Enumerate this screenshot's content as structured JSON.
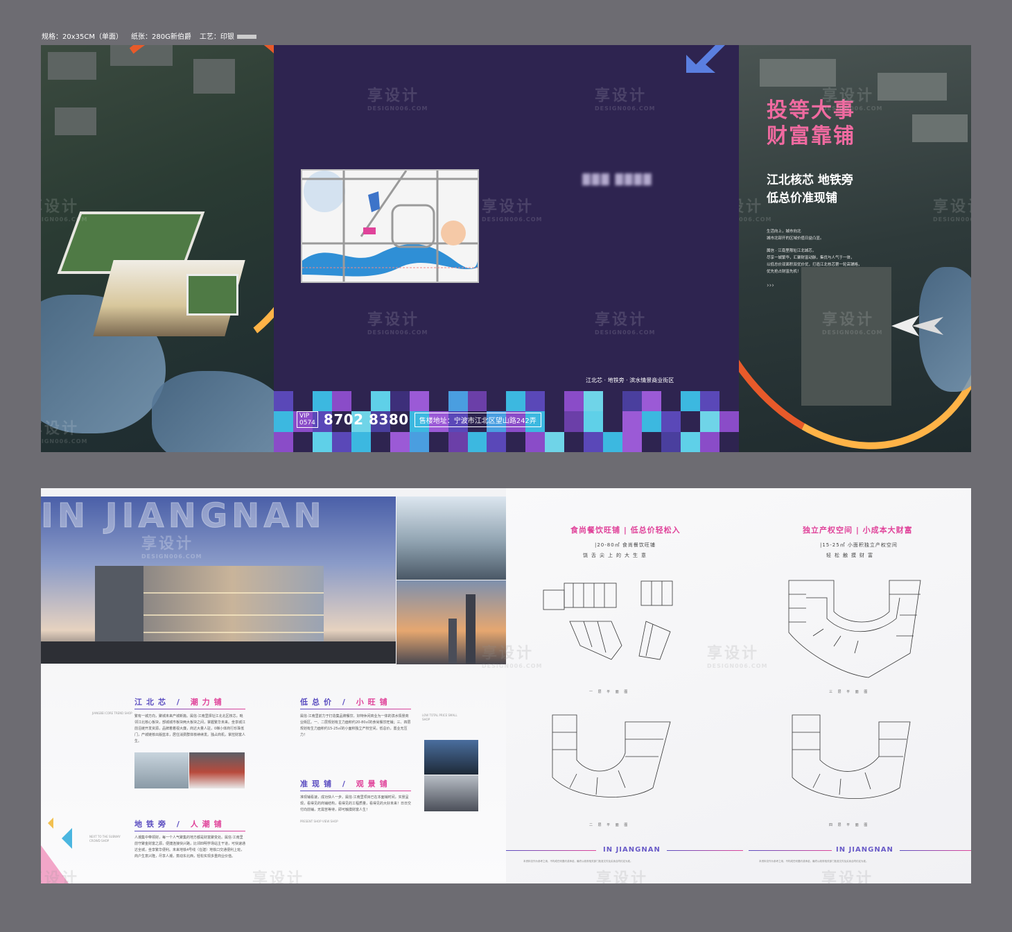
{
  "spec": {
    "size": "规格：20x35CM（单面）",
    "paper": "纸张：280G新伯爵",
    "craft": "工艺：印银"
  },
  "watermark": {
    "cn": "享设计",
    "en": "DESIGN006.COM"
  },
  "cover": {
    "tagline": "江北芯 · 地铁旁 · 滨水情景商业街区",
    "vip_label": "VIP",
    "area_code": "0574",
    "phone": "8702 8380",
    "address": "售楼地址：宁波市江北区望山路242弄"
  },
  "promo": {
    "headline_1": "投等大事",
    "headline_2": "财富靠铺",
    "sub_1": "江北核芯 地铁旁",
    "sub_2": "低总价准现铺",
    "body_1": "生活向上，城市向北",
    "body_2": "城市北部开的区域价值日益凸显。",
    "body_3": "属信 · 江南里限址江北城芯，",
    "body_4": "尽享一城繁华，汇聚财富动脉，集优与人气于一体，",
    "body_5": "以低总价双面积双优价优，打造江北核芯第一轮高铺格，",
    "body_6": "优先抢占财富先机！"
  },
  "inner": {
    "hero_title": "IN JIANGNAN",
    "sec1_a": "江北芯",
    "sec1_b": "潮力铺",
    "sec1_body": "繁有一城方向，聚城未来产城新篇。属信·江南里择址江北北区核芯，毗邻江北核心板块，部城城市板块两大板块之间，掌握繁华未来。坐享城江前沿链开发资源，品牌着着视大廉，商达大量人驻，0梯小体商行珍珠低门，产城链核出版蓝本，居住消费群体核续续发。独占商机，掌控财富人生。",
    "sec2_a": "低总价",
    "sec2_b": "小旺铺",
    "sec2_body": "属信·江南里前力于打造集品牌餐饮、好特休闲商业为一体的滨水情景商业街区。一、二层规划有主力面积约20-80㎡的食尚餐饮旺铺；三、四层规划有生力面积约15-25㎡的小面积独立产权空间，低总价，置业无压力！",
    "sec3_a": "地铁旁",
    "sec3_b": "人潮铺",
    "sec3_body": "人潮集中带领财，每一个人气聚集的地方都是财富聚变处。属信·江南里前守聚金财富之源，便捷连接快兴路，比邻四明学场站主干道，可快速通达全城，坐享繁华便利。未来地铁4号线（在建）地铁口交通便利上班，商户生意兴隆，尽享人潮，蒸动东北西，轻松实现多重商业价值。",
    "sec4_a": "准现铺",
    "sec4_b": "观景铺",
    "sec4_body": "准现铺看速，成功快人一步。属信·江南里项目已在本面铺时间，实景呈现，看得见的商铺结构，看得见的工程质量，看得见的大好未来！日日交付向前铺，无需苦等待，即可触摸财富人生！",
    "en_1": "JIANGBEI CORE TREND SHOP",
    "en_2": "LOW TOTAL PRICE SMALL SHOP",
    "en_3": "NEXT TO THE SUBWAY CROWD SHOP",
    "en_4": "PRESENT SHOP VIEW SHOP"
  },
  "floorplans": {
    "left_title": "食尚餐饮旺铺 | 低总价轻松入",
    "left_area": "|20-80㎡ 食尚餐饮旺铺",
    "left_slogan": "饶舌尖上的大生意",
    "right_title": "独立产权空间 | 小成本大财富",
    "right_area": "|15-25㎡ 小面积独立产权空间",
    "right_slogan": "轻松触摸财富",
    "cap_1f": "一 层 平 面 图",
    "cap_2f": "二 层 平 面 图",
    "cap_3f": "三 层 平 面 图",
    "cap_4f": "四 层 平 面 图",
    "footer_brand": "IN JIANGNAN",
    "disclaimer": "本资料仅作为参考之用，不构成任何要约或承诺，最终以政府相关部门批准文件及买卖合同约定为准。"
  },
  "colors": {
    "cover_bg": "#2e2450",
    "accent_pink": "#e0439a",
    "accent_purple": "#5a4cc0",
    "headline_pink": "#f06aa0"
  }
}
